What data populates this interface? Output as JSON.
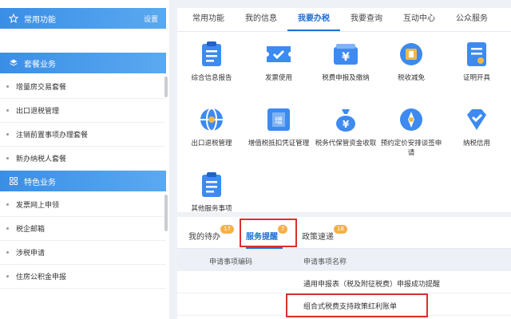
{
  "sidebar": {
    "common": {
      "title": "常用功能",
      "setting": "设置"
    },
    "package": {
      "title": "套餐业务",
      "items": [
        "增量房交易套餐",
        "出口退税管理",
        "注销前置事项办理套餐",
        "新办纳税人套餐"
      ]
    },
    "special": {
      "title": "特色业务",
      "items": [
        "发票网上申领",
        "税企邮箱",
        "涉税申请",
        "住房公积金申报"
      ]
    }
  },
  "tabs": [
    "常用功能",
    "我的信息",
    "我要办税",
    "我要查询",
    "互动中心",
    "公众服务"
  ],
  "services": [
    {
      "label": "综合信息报告",
      "icon": "document-list-icon"
    },
    {
      "label": "发票使用",
      "icon": "ticket-icon"
    },
    {
      "label": "税费申报及缴纳",
      "icon": "yen-wallet-icon"
    },
    {
      "label": "税收减免",
      "icon": "coin-icon"
    },
    {
      "label": "证明开具",
      "icon": "certificate-icon"
    },
    {
      "label": "出口退税管理",
      "icon": "globe-icon"
    },
    {
      "label": "增值税抵扣凭证管理",
      "icon": "invoice-stamp-icon"
    },
    {
      "label": "税务代保管资金收取",
      "icon": "money-bag-icon"
    },
    {
      "label": "预约定价安排谈签申请",
      "icon": "compass-icon"
    },
    {
      "label": "纳税信用",
      "icon": "shield-check-icon"
    },
    {
      "label": "其他服务事项",
      "icon": "document-list-icon"
    }
  ],
  "bottom_tabs": [
    {
      "label": "我的待办",
      "badge": "17"
    },
    {
      "label": "服务提醒",
      "badge": "7"
    },
    {
      "label": "政策速递",
      "badge": "18"
    }
  ],
  "table": {
    "headers": [
      "申请事项编码",
      "申请事项名称"
    ],
    "rows": [
      [
        "",
        "通用申报表（税及附征税费）申报成功提醒"
      ],
      [
        "",
        "组合式税费支持政策红利账单"
      ]
    ]
  },
  "colors": {
    "brand": "#1f6fd6",
    "header_gradient_start": "#3a8ee6",
    "highlight": "#d8302f",
    "badge": "#f5b04a"
  }
}
